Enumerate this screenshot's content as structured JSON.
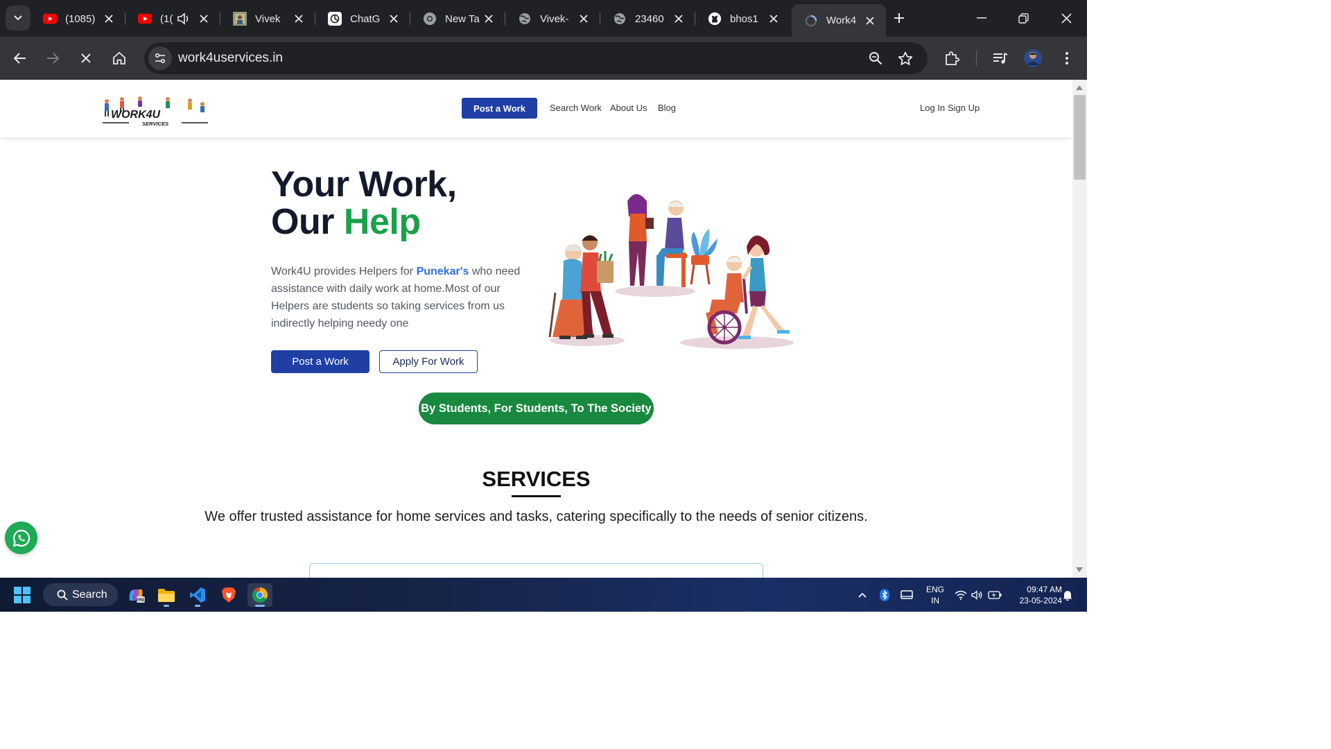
{
  "browser": {
    "tabs": [
      {
        "title": "(1085)",
        "icon": "youtube-icon"
      },
      {
        "title": "(1(",
        "icon": "youtube-icon"
      },
      {
        "title": "Vivek",
        "icon": "image-thumbnail-icon"
      },
      {
        "title": "ChatG",
        "icon": "chatgpt-icon"
      },
      {
        "title": "New Ta",
        "icon": "chrome-icon"
      },
      {
        "title": "Vivek-",
        "icon": "globe-icon"
      },
      {
        "title": "23460",
        "icon": "globe-icon"
      },
      {
        "title": "bhos1",
        "icon": "github-icon"
      },
      {
        "title": "Work4",
        "icon": "loading-icon"
      }
    ],
    "url": "work4uservices.in"
  },
  "site": {
    "logo_text": "WORK4U",
    "logo_sub": "SERVICES",
    "nav": {
      "post": "Post a Work",
      "search": "Search Work",
      "about": "About Us",
      "blog": "Blog",
      "login": "Log In",
      "signup": "Sign Up"
    },
    "hero": {
      "line1": "Your Work,",
      "line2_prefix": "Our ",
      "line2_highlight": "Help",
      "desc_pre": "Work4U provides Helpers for ",
      "desc_em": "Punekar's",
      "desc_post": " who need assistance with daily work at home.Most of our Helpers are students so taking services from us indirectly helping needy one",
      "btn_post": "Post a Work",
      "btn_apply": "Apply For Work"
    },
    "tagline": "By Students, For Students, To The Society",
    "services": {
      "title": "SERVICES",
      "desc": "We offer trusted assistance for home services and tasks, catering specifically to the needs of senior citizens."
    }
  },
  "taskbar": {
    "search": "Search",
    "lang_top": "ENG",
    "lang_bottom": "IN",
    "time": "09:47 AM",
    "date": "23-05-2024"
  },
  "colors": {
    "primary": "#1f3fa5",
    "accent_green": "#19a14a",
    "tagline_green": "#19893f",
    "link_blue": "#2f6fe0"
  }
}
